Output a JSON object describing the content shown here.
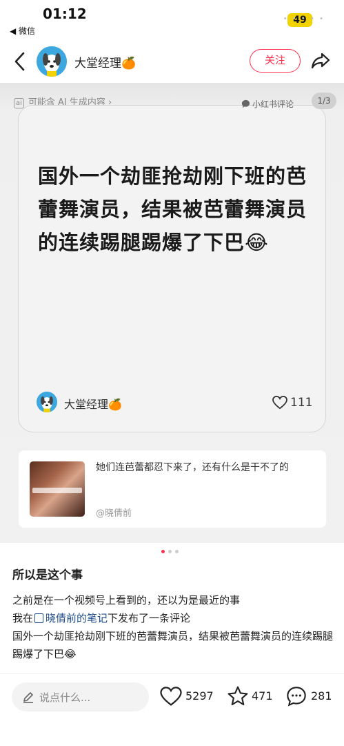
{
  "status": {
    "time": "01:12",
    "back_label": "◀ 微信",
    "battery": "49"
  },
  "header": {
    "author": "大堂经理🍊",
    "follow_label": "关注"
  },
  "image": {
    "ai_label": "可能含 AI 生成内容 ›",
    "ai_box": "ai",
    "source_label": "小红书评论",
    "page_indicator": "1/3",
    "quote": "国外一个劫匪抢劫刚下班的芭蕾舞演员，结果被芭蕾舞演员的连续踢腿踢爆了下巴😂",
    "card_author": "大堂经理🍊",
    "card_likes": "111",
    "comment": {
      "text": "她们连芭蕾都忍下来了，还有什么是干不了的",
      "user": "@晓倩前"
    }
  },
  "post": {
    "title": "所以是这个事",
    "line1": "之前是在一个视频号上看到的，还以为是最近的事",
    "line2_pre": "我在",
    "line2_link": "晓倩前的笔记",
    "line2_post": "下发布了一条评论",
    "line3": "国外一个劫匪抢劫刚下班的芭蕾舞演员，结果被芭蕾舞演员的连续踢腿踢爆了下巴😂"
  },
  "bottom": {
    "placeholder": "说点什么...",
    "likes": "5297",
    "collects": "471",
    "comments": "281"
  },
  "colors": {
    "accent": "#ff2e4d",
    "link": "#1f4d8c"
  }
}
